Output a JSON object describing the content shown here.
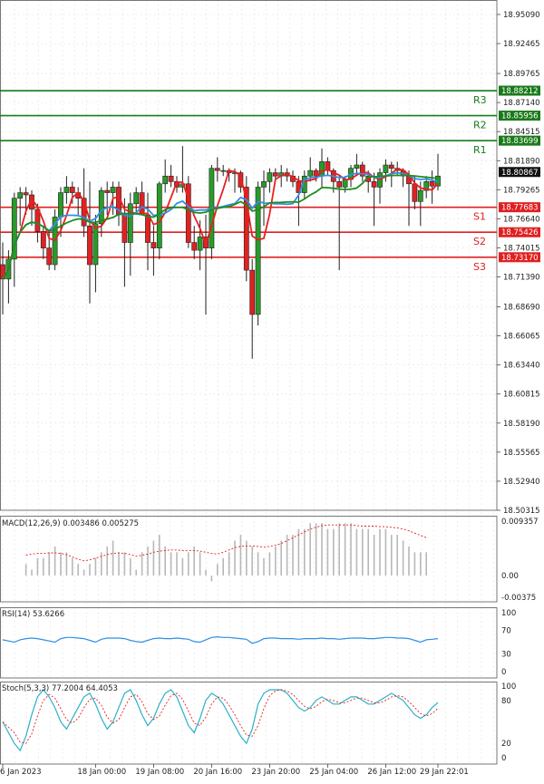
{
  "chart_data": [
    {
      "type": "candlestick",
      "panel": "price",
      "y_ticks": [
        "18.95090",
        "18.92465",
        "18.89765",
        "18.87140",
        "18.84515",
        "18.81890",
        "18.79265",
        "18.76640",
        "18.74015",
        "18.71390",
        "18.68690",
        "18.66065",
        "18.63440",
        "18.60815",
        "18.58190",
        "18.55565",
        "18.52940",
        "18.50315"
      ],
      "ylim": [
        18.50315,
        18.9509
      ],
      "last_price": "18.80867",
      "x_ticks": [
        {
          "label": "6 Jan 2023",
          "bar": 0
        },
        {
          "label": "18 Jan 00:00",
          "bar": 16
        },
        {
          "label": "19 Jan 08:00",
          "bar": 26
        },
        {
          "label": "20 Jan 16:00",
          "bar": 36
        },
        {
          "label": "23 Jan 20:00",
          "bar": 46
        },
        {
          "label": "25 Jan 04:00",
          "bar": 56
        },
        {
          "label": "26 Jan 12:00",
          "bar": 66
        },
        {
          "label": "29 Jan 22:01",
          "bar": 75
        }
      ],
      "levels": [
        {
          "name": "R3",
          "value": "18.88212",
          "color": "#1a7a1a"
        },
        {
          "name": "R2",
          "value": "18.85956",
          "color": "#1a7a1a"
        },
        {
          "name": "R1",
          "value": "18.83699",
          "color": "#1a7a1a"
        },
        {
          "name": "S1",
          "value": "18.77683",
          "color": "#e02020"
        },
        {
          "name": "S2",
          "value": "18.75426",
          "color": "#e02020"
        },
        {
          "name": "S3",
          "value": "18.73170",
          "color": "#e02020"
        }
      ],
      "candles": [
        [
          18.725,
          18.745,
          18.68,
          18.712
        ],
        [
          18.712,
          18.738,
          18.69,
          18.73
        ],
        [
          18.73,
          18.79,
          18.705,
          18.785
        ],
        [
          18.785,
          18.795,
          18.76,
          18.79
        ],
        [
          18.79,
          18.795,
          18.77,
          18.788
        ],
        [
          18.788,
          18.792,
          18.76,
          18.775
        ],
        [
          18.775,
          18.78,
          18.745,
          18.755
        ],
        [
          18.755,
          18.76,
          18.73,
          18.74
        ],
        [
          18.74,
          18.755,
          18.72,
          18.725
        ],
        [
          18.725,
          18.775,
          18.72,
          18.768
        ],
        [
          18.768,
          18.795,
          18.75,
          18.79
        ],
        [
          18.79,
          18.805,
          18.78,
          18.795
        ],
        [
          18.795,
          18.8,
          18.78,
          18.79
        ],
        [
          18.79,
          18.795,
          18.77,
          18.785
        ],
        [
          18.785,
          18.812,
          18.75,
          18.76
        ],
        [
          18.76,
          18.8,
          18.69,
          18.725
        ],
        [
          18.725,
          18.77,
          18.7,
          18.762
        ],
        [
          18.762,
          18.795,
          18.75,
          18.792
        ],
        [
          18.792,
          18.8,
          18.77,
          18.79
        ],
        [
          18.79,
          18.8,
          18.77,
          18.795
        ],
        [
          18.795,
          18.8,
          18.76,
          18.77
        ],
        [
          18.77,
          18.785,
          18.705,
          18.745
        ],
        [
          18.745,
          18.79,
          18.715,
          18.78
        ],
        [
          18.78,
          18.795,
          18.77,
          18.79
        ],
        [
          18.79,
          18.8,
          18.77,
          18.77
        ],
        [
          18.77,
          18.79,
          18.72,
          18.745
        ],
        [
          18.745,
          18.76,
          18.715,
          18.74
        ],
        [
          18.74,
          18.8,
          18.73,
          18.798
        ],
        [
          18.798,
          18.82,
          18.79,
          18.805
        ],
        [
          18.805,
          18.815,
          18.795,
          18.8
        ],
        [
          18.8,
          18.805,
          18.79,
          18.795
        ],
        [
          18.795,
          18.832,
          18.79,
          18.798
        ],
        [
          18.798,
          18.805,
          18.74,
          18.745
        ],
        [
          18.745,
          18.76,
          18.73,
          18.738
        ],
        [
          18.738,
          18.765,
          18.72,
          18.75
        ],
        [
          18.75,
          18.77,
          18.68,
          18.74
        ],
        [
          18.74,
          18.815,
          18.73,
          18.812
        ],
        [
          18.812,
          18.822,
          18.8,
          18.81
        ],
        [
          18.81,
          18.815,
          18.805,
          18.81
        ],
        [
          18.81,
          18.812,
          18.8,
          18.808
        ],
        [
          18.808,
          18.812,
          18.79,
          18.808
        ],
        [
          18.808,
          18.81,
          18.79,
          18.795
        ],
        [
          18.795,
          18.805,
          18.71,
          18.72
        ],
        [
          18.72,
          18.73,
          18.64,
          18.68
        ],
        [
          18.68,
          18.8,
          18.67,
          18.795
        ],
        [
          18.795,
          18.81,
          18.76,
          18.8
        ],
        [
          18.8,
          18.812,
          18.79,
          18.808
        ],
        [
          18.808,
          18.812,
          18.8,
          18.805
        ],
        [
          18.805,
          18.815,
          18.795,
          18.808
        ],
        [
          18.808,
          18.812,
          18.8,
          18.805
        ],
        [
          18.805,
          18.81,
          18.795,
          18.8
        ],
        [
          18.8,
          18.805,
          18.76,
          18.79
        ],
        [
          18.79,
          18.81,
          18.785,
          18.805
        ],
        [
          18.805,
          18.822,
          18.8,
          18.81
        ],
        [
          18.81,
          18.812,
          18.8,
          18.805
        ],
        [
          18.805,
          18.83,
          18.795,
          18.818
        ],
        [
          18.818,
          18.822,
          18.805,
          18.81
        ],
        [
          18.81,
          18.812,
          18.79,
          18.8
        ],
        [
          18.8,
          18.805,
          18.72,
          18.795
        ],
        [
          18.795,
          18.805,
          18.79,
          18.802
        ],
        [
          18.802,
          18.815,
          18.795,
          18.812
        ],
        [
          18.812,
          18.825,
          18.805,
          18.815
        ],
        [
          18.815,
          18.818,
          18.8,
          18.805
        ],
        [
          18.805,
          18.81,
          18.79,
          18.8
        ],
        [
          18.8,
          18.808,
          18.76,
          18.795
        ],
        [
          18.795,
          18.812,
          18.78,
          18.808
        ],
        [
          18.808,
          18.82,
          18.8,
          18.815
        ],
        [
          18.815,
          18.818,
          18.795,
          18.812
        ],
        [
          18.812,
          18.818,
          18.805,
          18.81
        ],
        [
          18.81,
          18.812,
          18.795,
          18.805
        ],
        [
          18.805,
          18.81,
          18.76,
          18.798
        ],
        [
          18.798,
          18.805,
          18.775,
          18.782
        ],
        [
          18.782,
          18.8,
          18.76,
          18.792
        ],
        [
          18.792,
          18.805,
          18.785,
          18.8
        ],
        [
          18.8,
          18.81,
          18.78,
          18.796
        ],
        [
          18.796,
          18.825,
          18.792,
          18.805
        ]
      ]
    },
    {
      "type": "macd",
      "label": "MACD(12,26,9) 0.003486 0.005275",
      "y_ticks": [
        "0.009357",
        "0.00",
        "-0.00375"
      ],
      "ylim": [
        -0.00375,
        0.009357
      ],
      "histogram": [
        0.002,
        0.001,
        0.003,
        0.003,
        0.004,
        0.005,
        0.004,
        0.004,
        0.003,
        0.002,
        0.001,
        0.002,
        0.003,
        0.004,
        0.005,
        0.006,
        0.004,
        0.004,
        0.003,
        0.001,
        0.004,
        0.005,
        0.006,
        0.007,
        0.005,
        0.004,
        0.004,
        0.003,
        0.004,
        0.005,
        0.004,
        0.001,
        -0.001,
        0.002,
        0.003,
        0.004,
        0.006,
        0.007,
        0.006,
        0.005,
        0.004,
        0.003,
        0.004,
        0.005,
        0.006,
        0.007,
        0.007,
        0.008,
        0.008,
        0.009,
        0.009,
        0.009,
        0.008,
        0.008,
        0.009,
        0.009,
        0.009,
        0.008,
        0.008,
        0.008,
        0.007,
        0.008,
        0.008,
        0.007,
        0.007,
        0.006,
        0.005,
        0.004,
        0.004,
        0.004
      ],
      "signal": [
        0.0035,
        0.0037,
        0.0038,
        0.0038,
        0.0039,
        0.0039,
        0.0038,
        0.0036,
        0.0032,
        0.0028,
        0.0025,
        0.0027,
        0.003,
        0.0033,
        0.0036,
        0.0038,
        0.0039,
        0.0038,
        0.0036,
        0.0033,
        0.0035,
        0.0037,
        0.004,
        0.0042,
        0.0043,
        0.0044,
        0.0044,
        0.0043,
        0.0043,
        0.0043,
        0.0042,
        0.004,
        0.0038,
        0.0037,
        0.004,
        0.0044,
        0.0048,
        0.005,
        0.0051,
        0.0051,
        0.005,
        0.0049,
        0.005,
        0.0052,
        0.0055,
        0.006,
        0.0065,
        0.007,
        0.0075,
        0.008,
        0.0083,
        0.0086,
        0.0087,
        0.0087,
        0.0087,
        0.0087,
        0.0087,
        0.0086,
        0.0085,
        0.0085,
        0.0085,
        0.0084,
        0.0084,
        0.0083,
        0.0082,
        0.008,
        0.0077,
        0.0073,
        0.0069,
        0.0065
      ]
    },
    {
      "type": "line",
      "label": "RSI(14) 53.6266",
      "y_ticks": [
        "100",
        "70",
        "30",
        "0"
      ],
      "ylim": [
        0,
        100
      ],
      "values": [
        54,
        52,
        50,
        54,
        56,
        57,
        56,
        54,
        52,
        50,
        56,
        58,
        58,
        57,
        56,
        53,
        50,
        55,
        57,
        57,
        57,
        56,
        53,
        51,
        50,
        53,
        56,
        57,
        56,
        56,
        57,
        56,
        55,
        51,
        50,
        54,
        58,
        59,
        58,
        58,
        57,
        56,
        55,
        48,
        51,
        56,
        57,
        57,
        56,
        56,
        56,
        55,
        56,
        56,
        56,
        57,
        56,
        56,
        55,
        56,
        57,
        57,
        57,
        56,
        56,
        57,
        58,
        58,
        57,
        57,
        56,
        53,
        50,
        54,
        55,
        56
      ]
    },
    {
      "type": "line",
      "label": "Stoch(5,3,3) 77.2004 64.4053",
      "y_ticks": [
        "100",
        "80",
        "20",
        "0"
      ],
      "ylim": [
        0,
        100
      ],
      "k": [
        50,
        35,
        20,
        10,
        30,
        60,
        85,
        95,
        85,
        70,
        50,
        40,
        55,
        70,
        85,
        90,
        75,
        55,
        40,
        50,
        70,
        90,
        95,
        80,
        60,
        45,
        55,
        75,
        90,
        95,
        85,
        65,
        45,
        35,
        55,
        80,
        90,
        85,
        75,
        60,
        45,
        30,
        20,
        40,
        75,
        90,
        95,
        95,
        95,
        90,
        80,
        70,
        65,
        70,
        80,
        85,
        80,
        75,
        75,
        80,
        85,
        85,
        80,
        75,
        75,
        80,
        85,
        90,
        85,
        80,
        70,
        60,
        55,
        60,
        70,
        77
      ]
    }
  ]
}
